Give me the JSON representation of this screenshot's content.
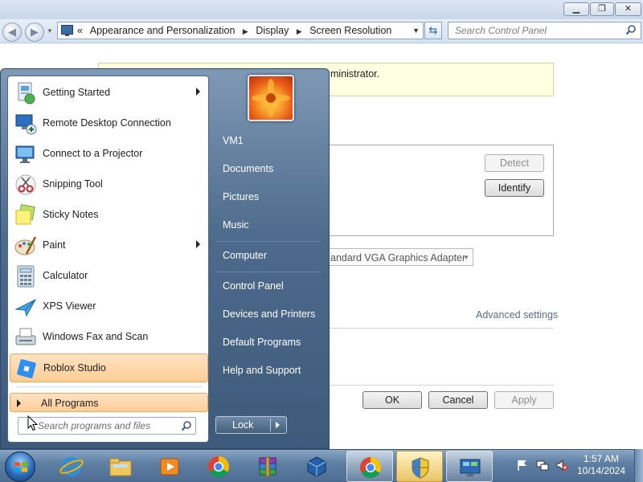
{
  "window": {
    "controls": {
      "minimize": "▁",
      "maximize": "❐",
      "close": "✕"
    },
    "nav": {
      "back_icon": "back-arrow-icon",
      "forward_icon": "forward-arrow-icon"
    },
    "address": {
      "prefix": "«",
      "crumbs": [
        "Appearance and Personalization",
        "Display",
        "Screen Resolution"
      ]
    },
    "search_placeholder": "Search Control Panel",
    "infobar_text": "ministrator.",
    "buttons": {
      "detect": "Detect",
      "identify": "Identify",
      "ok": "OK",
      "cancel": "Cancel",
      "apply": "Apply"
    },
    "adapter_value": "andard VGA Graphics Adapter",
    "advanced_link": "Advanced settings"
  },
  "start_menu": {
    "programs": [
      {
        "label": "Getting Started",
        "icon": "getting-started-icon",
        "submenu": true,
        "highlight": false
      },
      {
        "label": "Remote Desktop Connection",
        "icon": "remote-desktop-icon",
        "submenu": false,
        "highlight": false
      },
      {
        "label": "Connect to a Projector",
        "icon": "projector-icon",
        "submenu": false,
        "highlight": false
      },
      {
        "label": "Snipping Tool",
        "icon": "snipping-tool-icon",
        "submenu": false,
        "highlight": false
      },
      {
        "label": "Sticky Notes",
        "icon": "sticky-notes-icon",
        "submenu": false,
        "highlight": false
      },
      {
        "label": "Paint",
        "icon": "paint-icon",
        "submenu": true,
        "highlight": false
      },
      {
        "label": "Calculator",
        "icon": "calculator-icon",
        "submenu": false,
        "highlight": false
      },
      {
        "label": "XPS Viewer",
        "icon": "xps-viewer-icon",
        "submenu": false,
        "highlight": false
      },
      {
        "label": "Windows Fax and Scan",
        "icon": "fax-scan-icon",
        "submenu": false,
        "highlight": false
      },
      {
        "label": "Roblox Studio",
        "icon": "roblox-studio-icon",
        "submenu": false,
        "highlight": true
      }
    ],
    "all_programs": "All Programs",
    "search_placeholder": "Search programs and files",
    "user_picture": "flower-user-picture",
    "right_items": [
      "VM1",
      "Documents",
      "Pictures",
      "Music",
      "Computer",
      "Control Panel",
      "Devices and Printers",
      "Default Programs",
      "Help and Support"
    ],
    "lock_label": "Lock"
  },
  "taskbar": {
    "pinned": [
      "internet-explorer-icon",
      "windows-explorer-icon",
      "media-player-icon",
      "chrome-icon",
      "winrar-icon",
      "virtualbox-icon",
      "chrome-icon",
      "windows-update-shield-icon",
      "control-panel-icon"
    ],
    "tray": [
      "action-center-flag-icon",
      "network-icon",
      "volume-muted-icon"
    ],
    "time": "1:57 AM",
    "date": "10/14/2024"
  }
}
